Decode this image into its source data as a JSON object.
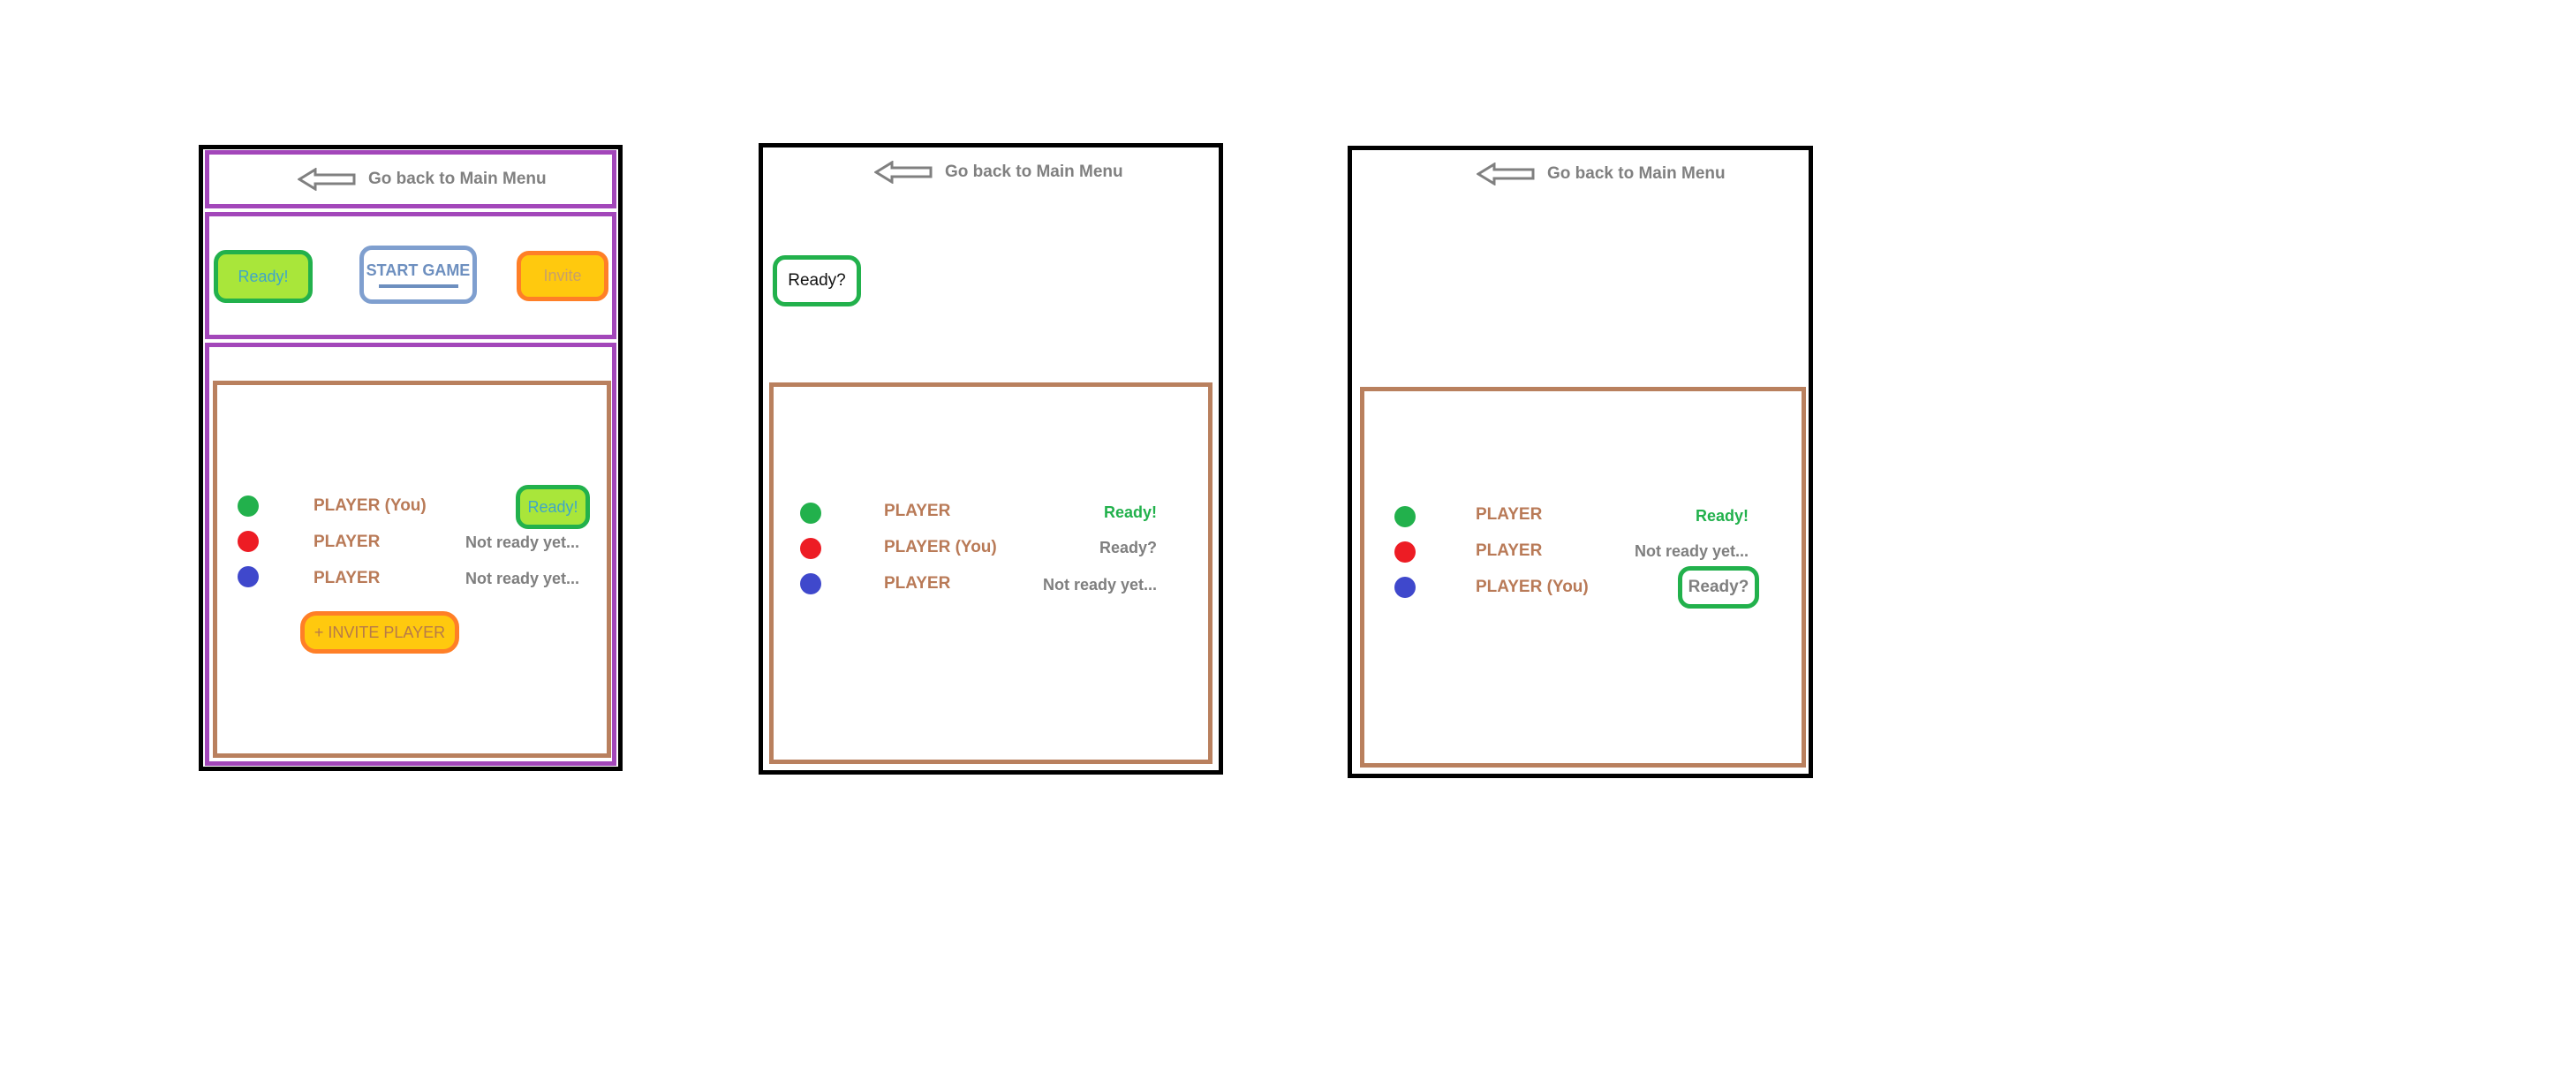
{
  "back_label": "Go back to Main Menu",
  "colors": {
    "frame": "#000000",
    "section_border": "#a347ba",
    "player_panel_border": "#b9805e",
    "ready_green": "#22b14c",
    "lime": "#a9e63a",
    "orange_fill": "#ffc90e",
    "orange_border": "#ff7f27",
    "player_name": "#b97a57",
    "status_gray": "#7f7f7f"
  },
  "screen1": {
    "back_label": "Go back to Main Menu",
    "ready_button": "Ready!",
    "start_button": "START GAME",
    "invite_button_small": "Invite",
    "players": [
      {
        "name": "PLAYER (You)",
        "color": "green",
        "status": "Ready!"
      },
      {
        "name": "PLAYER",
        "color": "red",
        "status": "Not ready yet..."
      },
      {
        "name": "PLAYER",
        "color": "blue",
        "status": "Not ready yet..."
      }
    ],
    "invite_player_button": "+ INVITE PLAYER"
  },
  "screen2": {
    "back_label": "Go back to Main Menu",
    "ready_button": "Ready?",
    "players": [
      {
        "name": "PLAYER",
        "color": "green",
        "status": "Ready!"
      },
      {
        "name": "PLAYER (You)",
        "color": "red",
        "status": "Ready?"
      },
      {
        "name": "PLAYER",
        "color": "blue",
        "status": "Not ready yet..."
      }
    ]
  },
  "screen3": {
    "back_label": "Go back to Main Menu",
    "players": [
      {
        "name": "PLAYER",
        "color": "green",
        "status": "Ready!"
      },
      {
        "name": "PLAYER",
        "color": "red",
        "status": "Not ready yet..."
      },
      {
        "name": "PLAYER (You)",
        "color": "blue",
        "status": "Ready?"
      }
    ]
  }
}
